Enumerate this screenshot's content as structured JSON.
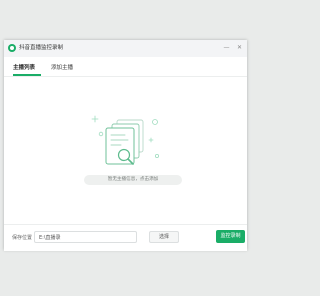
{
  "window": {
    "title": "抖音直播监控录制",
    "controls": {
      "minimize_icon": "minimize-icon",
      "close_icon": "close-icon"
    }
  },
  "tabs": [
    {
      "label": "主播列表",
      "active": true
    },
    {
      "label": "添加主播",
      "active": false
    }
  ],
  "empty_state": {
    "icon": "empty-documents-search-icon",
    "message": "暂无主播信息，点击添加"
  },
  "footer": {
    "save_location_label": "保存位置",
    "path_value": "E:\\直播录",
    "browse_label": "选择",
    "monitor_label": "监控录制"
  },
  "colors": {
    "accent": "#1aad67",
    "background": "#e9ebea",
    "titlebar": "#f3f4f6"
  }
}
